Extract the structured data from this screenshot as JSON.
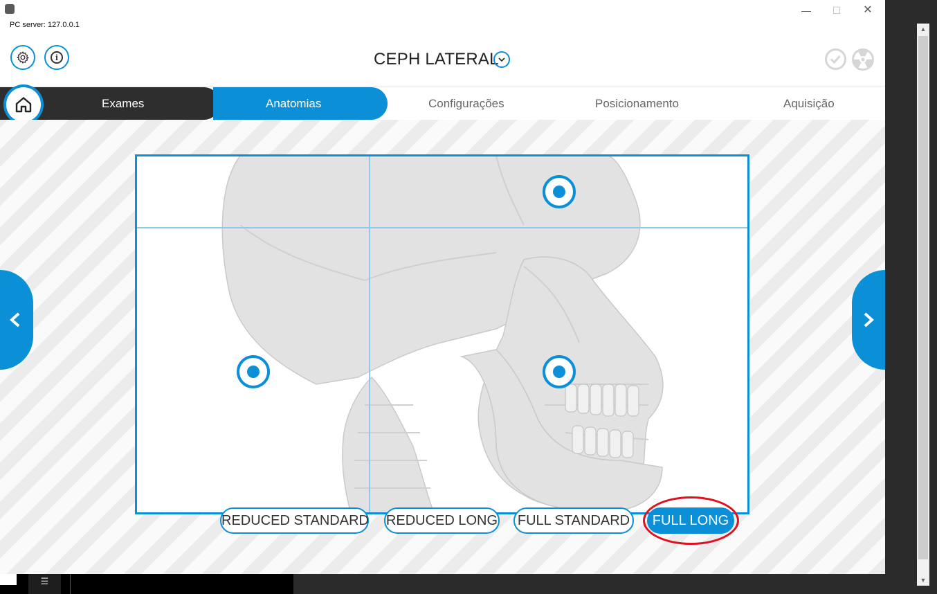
{
  "window": {
    "server_label": "PC server: 127.0.0.1",
    "minimize_glyph": "—",
    "maximize_glyph": "☐",
    "close_glyph": "✕"
  },
  "header": {
    "exam_title": "CEPH LATERAL",
    "icons": {
      "settings": "gear-icon",
      "info": "info-icon",
      "info_glyph": "i",
      "dropdown": "chevron-down-icon",
      "status_check": "check-circle-icon",
      "status_radiation": "radiation-icon"
    }
  },
  "tabs": [
    {
      "label": "Exames",
      "state": "completed"
    },
    {
      "label": "Anatomias",
      "state": "active"
    },
    {
      "label": "Configurações",
      "state": "pending"
    },
    {
      "label": "Posicionamento",
      "state": "pending"
    },
    {
      "label": "Aquisição",
      "state": "pending"
    }
  ],
  "field_of_view": {
    "options": [
      {
        "label": "REDUCED STANDARD",
        "selected": false
      },
      {
        "label": "REDUCED LONG",
        "selected": false
      },
      {
        "label": "FULL STANDARD",
        "selected": false
      },
      {
        "label": "FULL LONG",
        "selected": true
      }
    ]
  },
  "scrollbar": {
    "up_glyph": "▲",
    "down_glyph": "▼"
  },
  "taskbar": {
    "icon_glyph": "☰"
  },
  "colors": {
    "accent": "#0b8fd6",
    "dark_tab": "#2e2e2e",
    "highlight": "#e0101e",
    "grid_line": "#8ecbea"
  }
}
